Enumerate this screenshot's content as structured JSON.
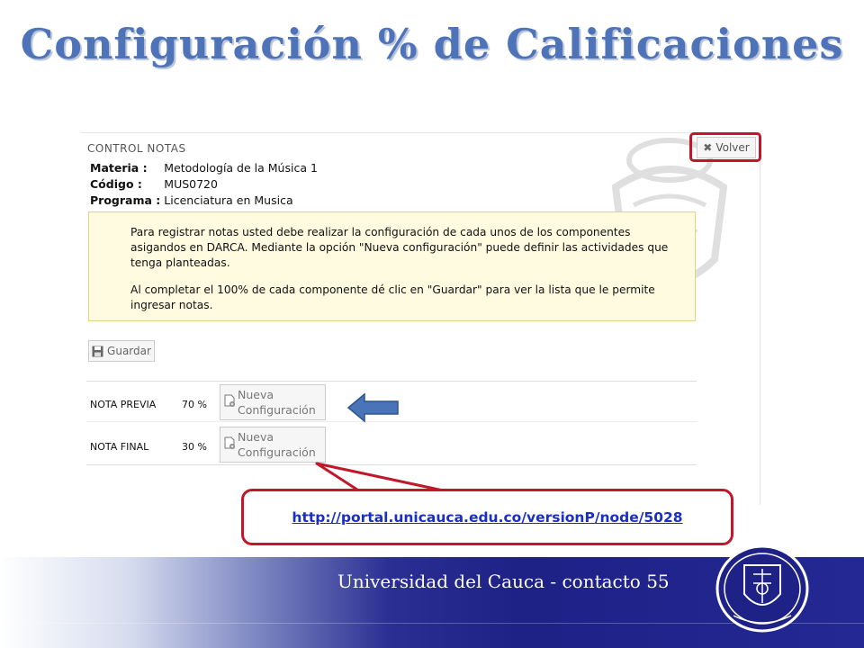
{
  "slide": {
    "title": "Configuración % de Calificaciones",
    "footer": "Universidad del Cauca - contacto 55",
    "link": "http://portal.unicauca.edu.co/versionP/node/5028"
  },
  "panel": {
    "title": "CONTROL NOTAS",
    "volver_label": "Volver",
    "info": [
      {
        "label": "Materia :",
        "value": "Metodología de la Música 1"
      },
      {
        "label": "Código :",
        "value": "MUS0720"
      },
      {
        "label": "Programa :",
        "value": "Licenciatura en Musica"
      }
    ],
    "notice": {
      "p1": "Para registrar notas usted debe realizar la configuración de cada unos de los componentes asigandos en DARCA. Mediante la opción \"Nueva configuración\" puede definir las actividades que tenga planteadas.",
      "p2": "Al completar el 100% de cada componente dé clic en \"Guardar\" para ver la lista que le permite ingresar notas."
    },
    "guardar_label": "Guardar",
    "components": [
      {
        "name": "NOTA PREVIA",
        "percent": "70 %",
        "button_line1": "Nueva",
        "button_line2": "Configuración"
      },
      {
        "name": "NOTA FINAL",
        "percent": "30 %",
        "button_line1": "Nueva",
        "button_line2": "Configuración"
      }
    ]
  },
  "colors": {
    "title": "#4f73b8",
    "highlight": "#c0172a",
    "link": "#1a2fc4",
    "footer": "#1e2185",
    "arrow": "#4a74b8"
  },
  "icons": [
    "close-icon",
    "save-icon",
    "new-document-icon",
    "left-arrow-icon",
    "university-seal-icon"
  ]
}
